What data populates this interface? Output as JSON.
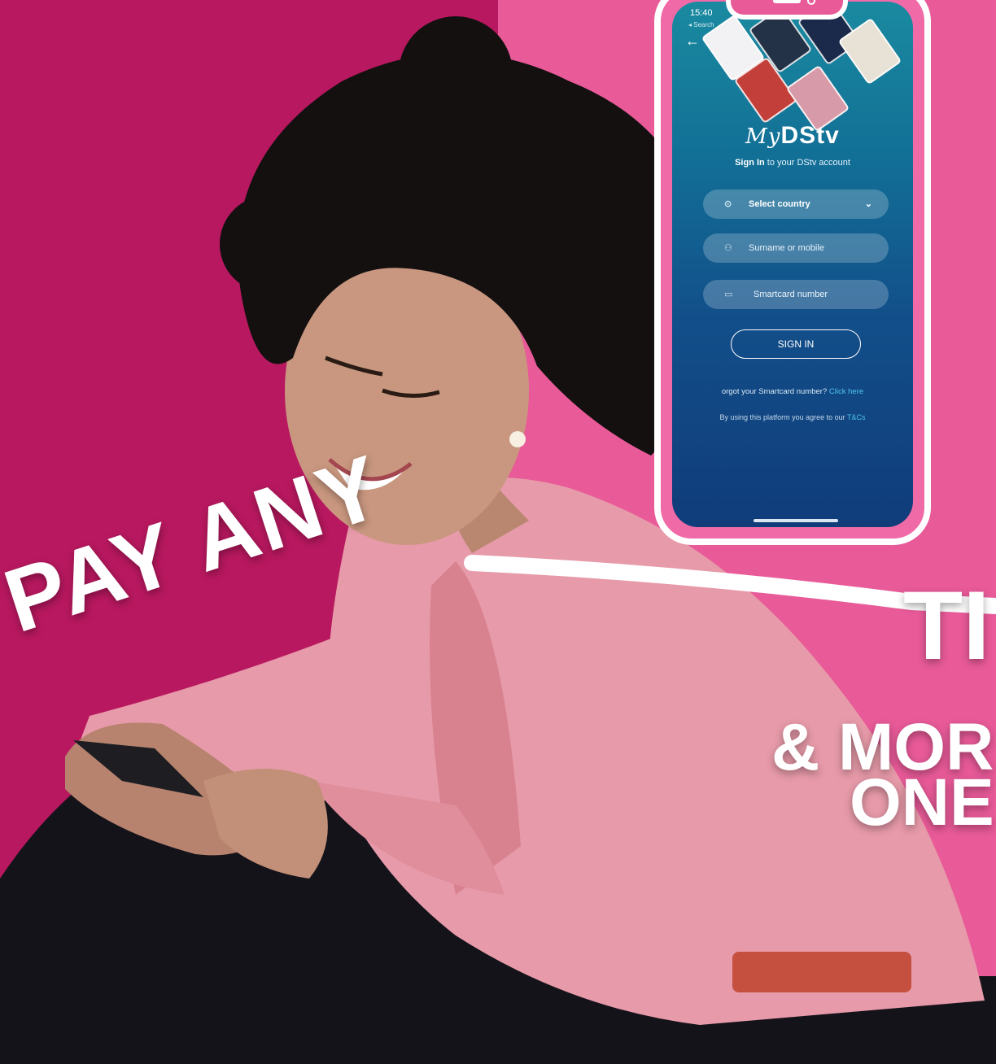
{
  "headline": {
    "line1": "PAY ANY",
    "line1_cont": "TI",
    "line2": "& MOR",
    "line3": "ONE"
  },
  "phone": {
    "status_time": "15:40",
    "status_back": "◂ Search",
    "back_icon": "arrow-left-icon",
    "logo_my": "My",
    "logo_brand": "DStv",
    "subtitle_bold": "Sign In",
    "subtitle_rest": " to your DStv account",
    "country_select": {
      "label": "Select country",
      "icon": "location-pin-icon"
    },
    "surname_field": {
      "placeholder": "Surname or mobile",
      "icon": "user-icon"
    },
    "smartcard_field": {
      "placeholder": "Smartcard number",
      "icon": "card-icon"
    },
    "sign_in_button": "SIGN IN",
    "forgot_text": "orgot your Smartcard number?",
    "forgot_link": "Click here",
    "terms_text": "By using this platform you agree to our",
    "terms_link": "T&Cs"
  },
  "colors": {
    "bg_left": "#b8185f",
    "bg_right": "#e85a98",
    "accent_link": "#4fc3ef"
  }
}
